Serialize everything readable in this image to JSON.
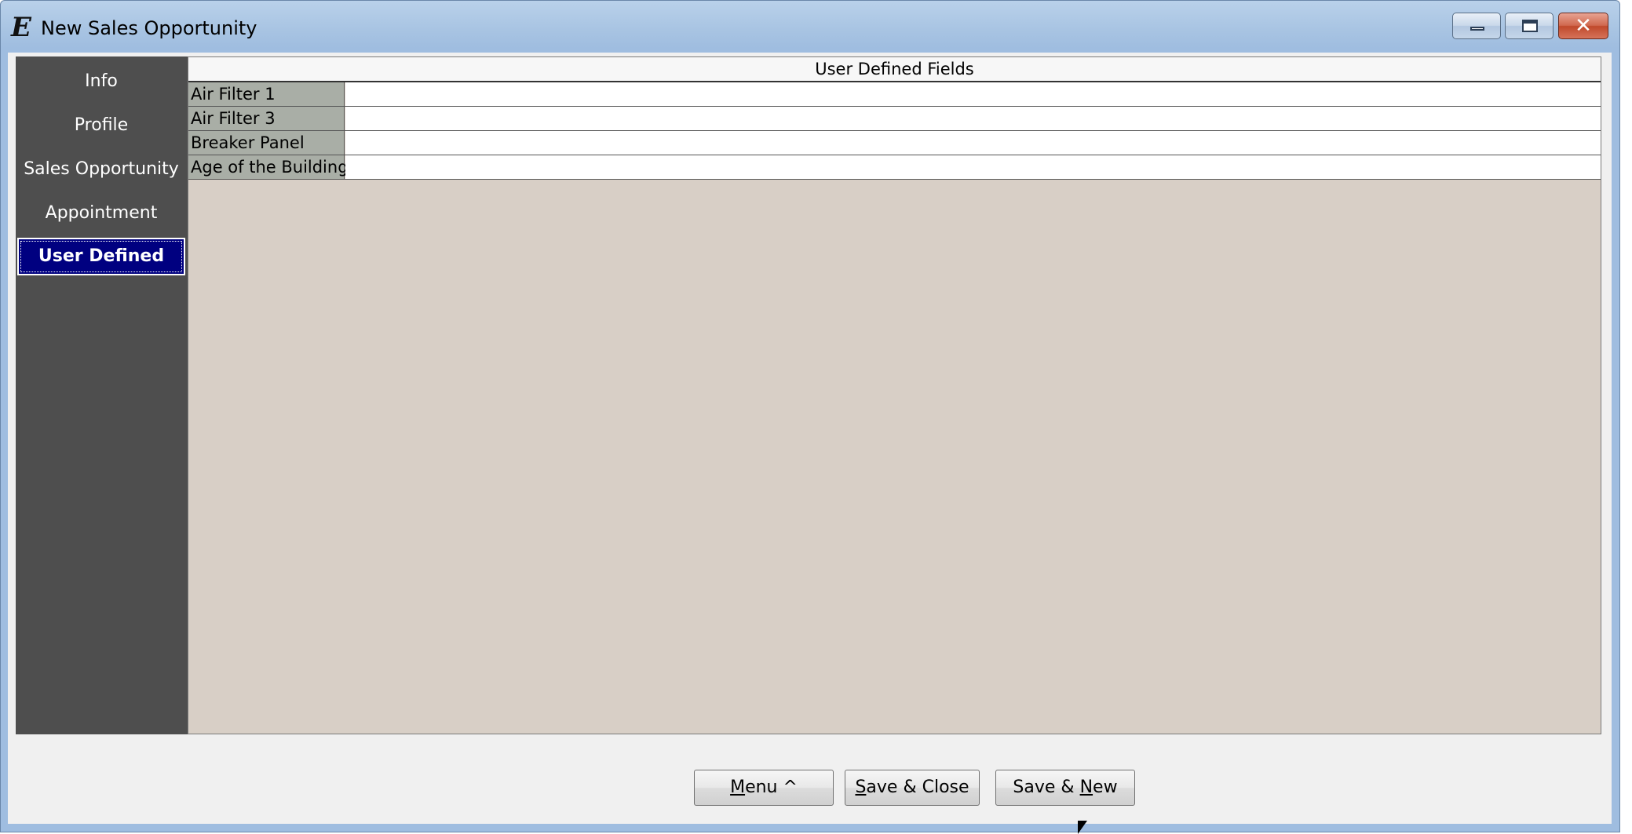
{
  "window": {
    "title": "New Sales Opportunity",
    "app_icon_glyph": "E",
    "controls": {
      "minimize_icon": "minimize-icon",
      "maximize_icon": "maximize-icon",
      "close_icon": "close-icon",
      "close_glyph": "✕"
    }
  },
  "sidebar": {
    "items": [
      {
        "label": "Info",
        "active": false
      },
      {
        "label": "Profile",
        "active": false
      },
      {
        "label": "Sales Opportunity",
        "active": false
      },
      {
        "label": "Appointment",
        "active": false
      },
      {
        "label": "User Defined",
        "active": true
      }
    ]
  },
  "panel": {
    "header": "User Defined Fields",
    "fields": [
      {
        "label": "Air Filter 1",
        "value": ""
      },
      {
        "label": "Air Filter 3",
        "value": ""
      },
      {
        "label": "Breaker Panel",
        "value": ""
      },
      {
        "label": "Age of the Building",
        "value": ""
      }
    ]
  },
  "buttons": {
    "menu": {
      "pre": "",
      "mnemonic": "M",
      "post": "enu ^"
    },
    "save_close": {
      "pre": "",
      "mnemonic": "S",
      "post": "ave & Close"
    },
    "save_new": {
      "pre": "Save & ",
      "mnemonic": "N",
      "post": "ew"
    }
  },
  "colors": {
    "sidebar_bg": "#4e4e4e",
    "active_item_bg": "#000080",
    "panel_bg": "#d8cfc6",
    "label_bg": "#a9aea6"
  }
}
